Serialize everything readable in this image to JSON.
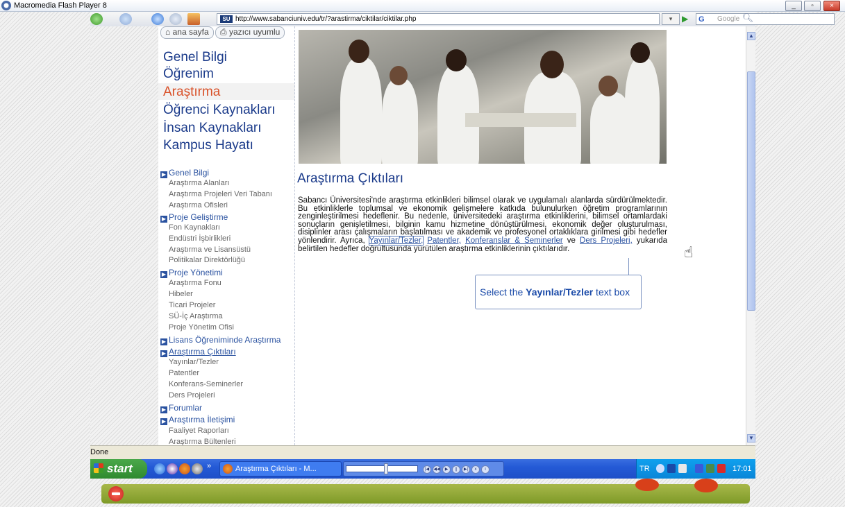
{
  "window": {
    "title": "Macromedia Flash Player 8",
    "controls": [
      "_",
      "▫",
      "×"
    ]
  },
  "browser": {
    "url": "http://www.sabanciuniv.edu/tr/?arastirma/ciktilar/ciktilar.php",
    "site_badge": "SU",
    "search_engine": "G",
    "search_placeholder": "Google",
    "status": "Done"
  },
  "top_buttons": {
    "home": "ana sayfa",
    "print": "yazıcı uyumlu"
  },
  "main_nav": [
    {
      "label": "Genel Bilgi"
    },
    {
      "label": "Öğrenim"
    },
    {
      "label": "Araştırma"
    },
    {
      "label": "Öğrenci Kaynakları"
    },
    {
      "label": "İnsan Kaynakları"
    },
    {
      "label": "Kampus Hayatı"
    }
  ],
  "sub_nav": {
    "genel_bilgi": "Genel Bilgi",
    "genel_items": [
      "Araştırma Alanları",
      "Araştırma Projeleri Veri Tabanı",
      "Araştırma Ofisleri"
    ],
    "proje_gelistirme": "Proje Geliştirme",
    "proje_gelistirme_items": [
      "Fon Kaynakları",
      "Endüstri İşbirlikleri",
      "Araştırma ve Lisansüstü",
      "Politikalar Direktörlüğü"
    ],
    "proje_yonetimi": "Proje Yönetimi",
    "proje_yonetimi_items": [
      "Araştırma Fonu",
      "Hibeler",
      "Ticari Projeler",
      "SÜ-İç Araştırma",
      "Proje Yönetim Ofisi"
    ],
    "lisans": "Lisans Öğreniminde Araştırma",
    "ciktilar": "Araştırma Çıktıları",
    "ciktilar_items": [
      "Yayınlar/Tezler",
      "Patentler",
      "Konferans-Seminerler",
      "Ders Projeleri"
    ],
    "forumlar": "Forumlar",
    "iletisim": "Araştırma İletişimi",
    "iletisim_items": [
      "Faaliyet Raporları",
      "Araştırma Bültenleri"
    ]
  },
  "content": {
    "title": "Araştırma Çıktıları",
    "p1": "Sabancı Üniversitesi'nde araştırma etkinlikleri bilimsel olarak ve uygulamalı alanlarda sürdürülmektedir. Bu etkinliklerle toplumsal ve ekonomik gelişmelere katkıda bulunulurken öğretim programlarının zenginleştirilmesi hedeflenir. Bu nedenle, üniversitedeki araştırma etkinliklerini, bilimsel ortamlardaki sonuçların genişletilmesi, bilginin kamu hizmetine dönüştürülmesi, ekonomik değer oluşturulması, disiplinler arası çalışmaların başlatılması ve akademik ve profesyonel ortaklıklara girilmesi gibi hedefler yönlendirir. Ayrıca,",
    "link1": "Yayınlar/Tezler,",
    "link2": "Patentler,",
    "link3": "Konferanslar & Seminerler",
    "p2": " ve ",
    "link4": "Ders Projeleri,",
    "p3": " yukarıda belirtilen hedefler doğrultusunda yürütülen araştırma etkinliklerinin çıktılarıdır."
  },
  "callout": {
    "prefix": "Select the ",
    "bold": "Yayınlar/Tezler",
    "suffix": " text box"
  },
  "taskbar": {
    "start": "start",
    "app": "Araştırma Çıktıları - M...",
    "lang": "TR",
    "clock": "17:01",
    "chevron": "»"
  },
  "colors": {
    "nav_blue": "#1a3a8a",
    "nav_active": "#d9522a",
    "link_blue": "#2a52a0",
    "taskbar": "#245ad6",
    "start_green": "#3a9a3a"
  }
}
